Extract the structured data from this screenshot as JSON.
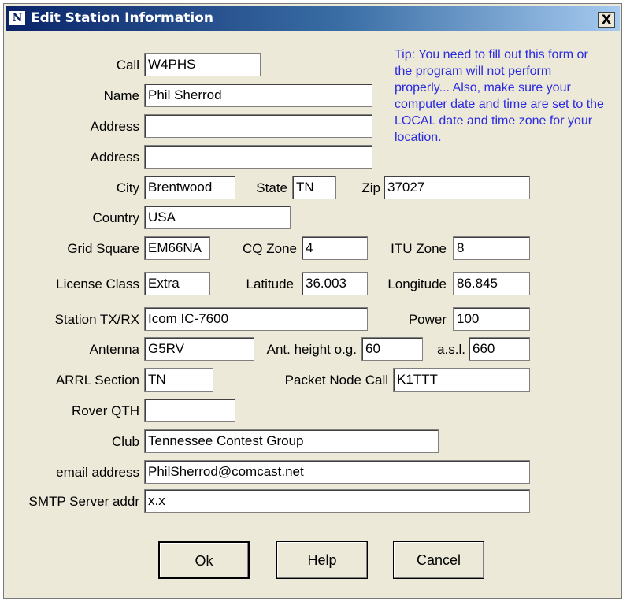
{
  "window": {
    "title": "Edit Station Information",
    "icon": "N1MM-app-icon",
    "close_label": "X"
  },
  "tip": "Tip: You need to fill out this form or the program will not perform properly... Also, make sure your computer date and time are set to the LOCAL date and time zone for your location.",
  "fields": {
    "call": {
      "label": "Call",
      "value": "W4PHS"
    },
    "name": {
      "label": "Name",
      "value": "Phil Sherrod"
    },
    "address1": {
      "label": "Address",
      "value": ""
    },
    "address2": {
      "label": "Address",
      "value": ""
    },
    "city": {
      "label": "City",
      "value": "Brentwood"
    },
    "state": {
      "label": "State",
      "value": "TN"
    },
    "zip": {
      "label": "Zip",
      "value": "37027"
    },
    "country": {
      "label": "Country",
      "value": "USA"
    },
    "grid_square": {
      "label": "Grid Square",
      "value": "EM66NA"
    },
    "cq_zone": {
      "label": "CQ Zone",
      "value": "4"
    },
    "itu_zone": {
      "label": "ITU Zone",
      "value": "8"
    },
    "license_class": {
      "label": "License Class",
      "value": "Extra"
    },
    "latitude": {
      "label": "Latitude",
      "value": "36.003"
    },
    "longitude": {
      "label": "Longitude",
      "value": "86.845"
    },
    "station_txrx": {
      "label": "Station TX/RX",
      "value": "Icom IC-7600"
    },
    "power": {
      "label": "Power",
      "value": "100"
    },
    "antenna": {
      "label": "Antenna",
      "value": "G5RV"
    },
    "ant_height": {
      "label": "Ant. height o.g.",
      "value": "60"
    },
    "asl": {
      "label": "a.s.l.",
      "value": "660"
    },
    "arrl_section": {
      "label": "ARRL Section",
      "value": "TN"
    },
    "packet_node_call": {
      "label": "Packet Node Call",
      "value": "K1TTT"
    },
    "rover_qth": {
      "label": "Rover QTH",
      "value": ""
    },
    "club": {
      "label": "Club",
      "value": "Tennessee Contest Group"
    },
    "email": {
      "label": "email address",
      "value": "PhilSherrod@comcast.net"
    },
    "smtp": {
      "label": "SMTP Server addr",
      "value": "x.x"
    }
  },
  "buttons": {
    "ok": "Ok",
    "help": "Help",
    "cancel": "Cancel"
  },
  "colors": {
    "title_bar": "#0a246a",
    "tip_text": "#2a2ae0",
    "dialog_bg": "#ece9d8"
  }
}
